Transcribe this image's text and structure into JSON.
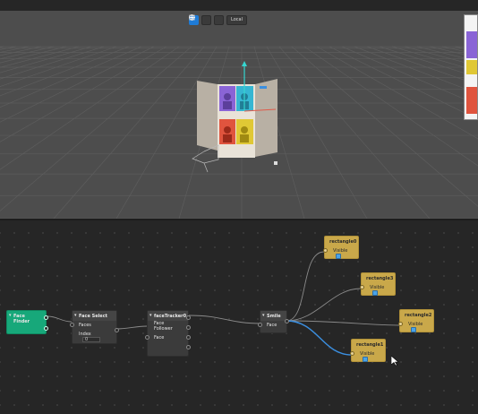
{
  "toolbar": {
    "local_label": "Local",
    "accent": "#1e7bd6"
  },
  "viewport": {
    "grid_color": "#5d5d5d",
    "background": "#4d4d4d",
    "object_colors": [
      "#8a64d6",
      "#36b6d2",
      "#e0543e",
      "#e0c835"
    ]
  },
  "patch": {
    "face_finder": {
      "title": "Face Finder"
    },
    "face_select": {
      "title": "Face Select",
      "faces_label": "Faces",
      "index_label": "Index",
      "index_value": "0"
    },
    "face_tracker": {
      "title": "faceTracker0",
      "follower_label": "Face Follower",
      "face_label": "Face"
    },
    "smile": {
      "title": "Smile",
      "face_label": "Face"
    },
    "rectangle0": {
      "title": "rectangle0",
      "visible_label": "Visible"
    },
    "rectangle3": {
      "title": "rectangle3",
      "visible_label": "Visible"
    },
    "rectangle2": {
      "title": "rectangle2",
      "visible_label": "Visible"
    },
    "rectangle1": {
      "title": "rectangle1",
      "visible_label": "Visible"
    },
    "wire_color": "#8a8a8a",
    "selected_wire_color": "#3b8fe0"
  }
}
